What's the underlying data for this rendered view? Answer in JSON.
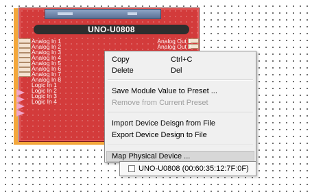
{
  "module": {
    "title": "UNO-U0808",
    "inputs": [
      "Analog In 1",
      "Analog In 2",
      "Analog In 3",
      "Analog In 4",
      "Analog In 5",
      "Analog In 6",
      "Analog In 7",
      "Analog In 8",
      "Logic In 1",
      "Logic In 2",
      "Logic In 3",
      "Logic In 4"
    ],
    "outputs": [
      "Analog Out 1",
      "Analog Out 2"
    ],
    "color": "#d33b3b",
    "selection_color": "#f3a73b"
  },
  "context_menu": {
    "items": [
      {
        "label": "Copy",
        "shortcut": "Ctrl+C",
        "enabled": true
      },
      {
        "label": "Delete",
        "shortcut": "Del",
        "enabled": true
      },
      {
        "label": "Save Module Value to Preset ...",
        "enabled": true
      },
      {
        "label": "Remove from Current Preset",
        "enabled": false
      },
      {
        "label": "Import Device Deisgn from File",
        "enabled": true
      },
      {
        "label": "Export Device Design to File",
        "enabled": true
      },
      {
        "label": "Map Physical Device ...",
        "enabled": true,
        "highlighted": true
      }
    ]
  },
  "submenu": {
    "device_label": "UNO-U0808 (00:60:35:12:7F:0F)",
    "checked": false
  }
}
